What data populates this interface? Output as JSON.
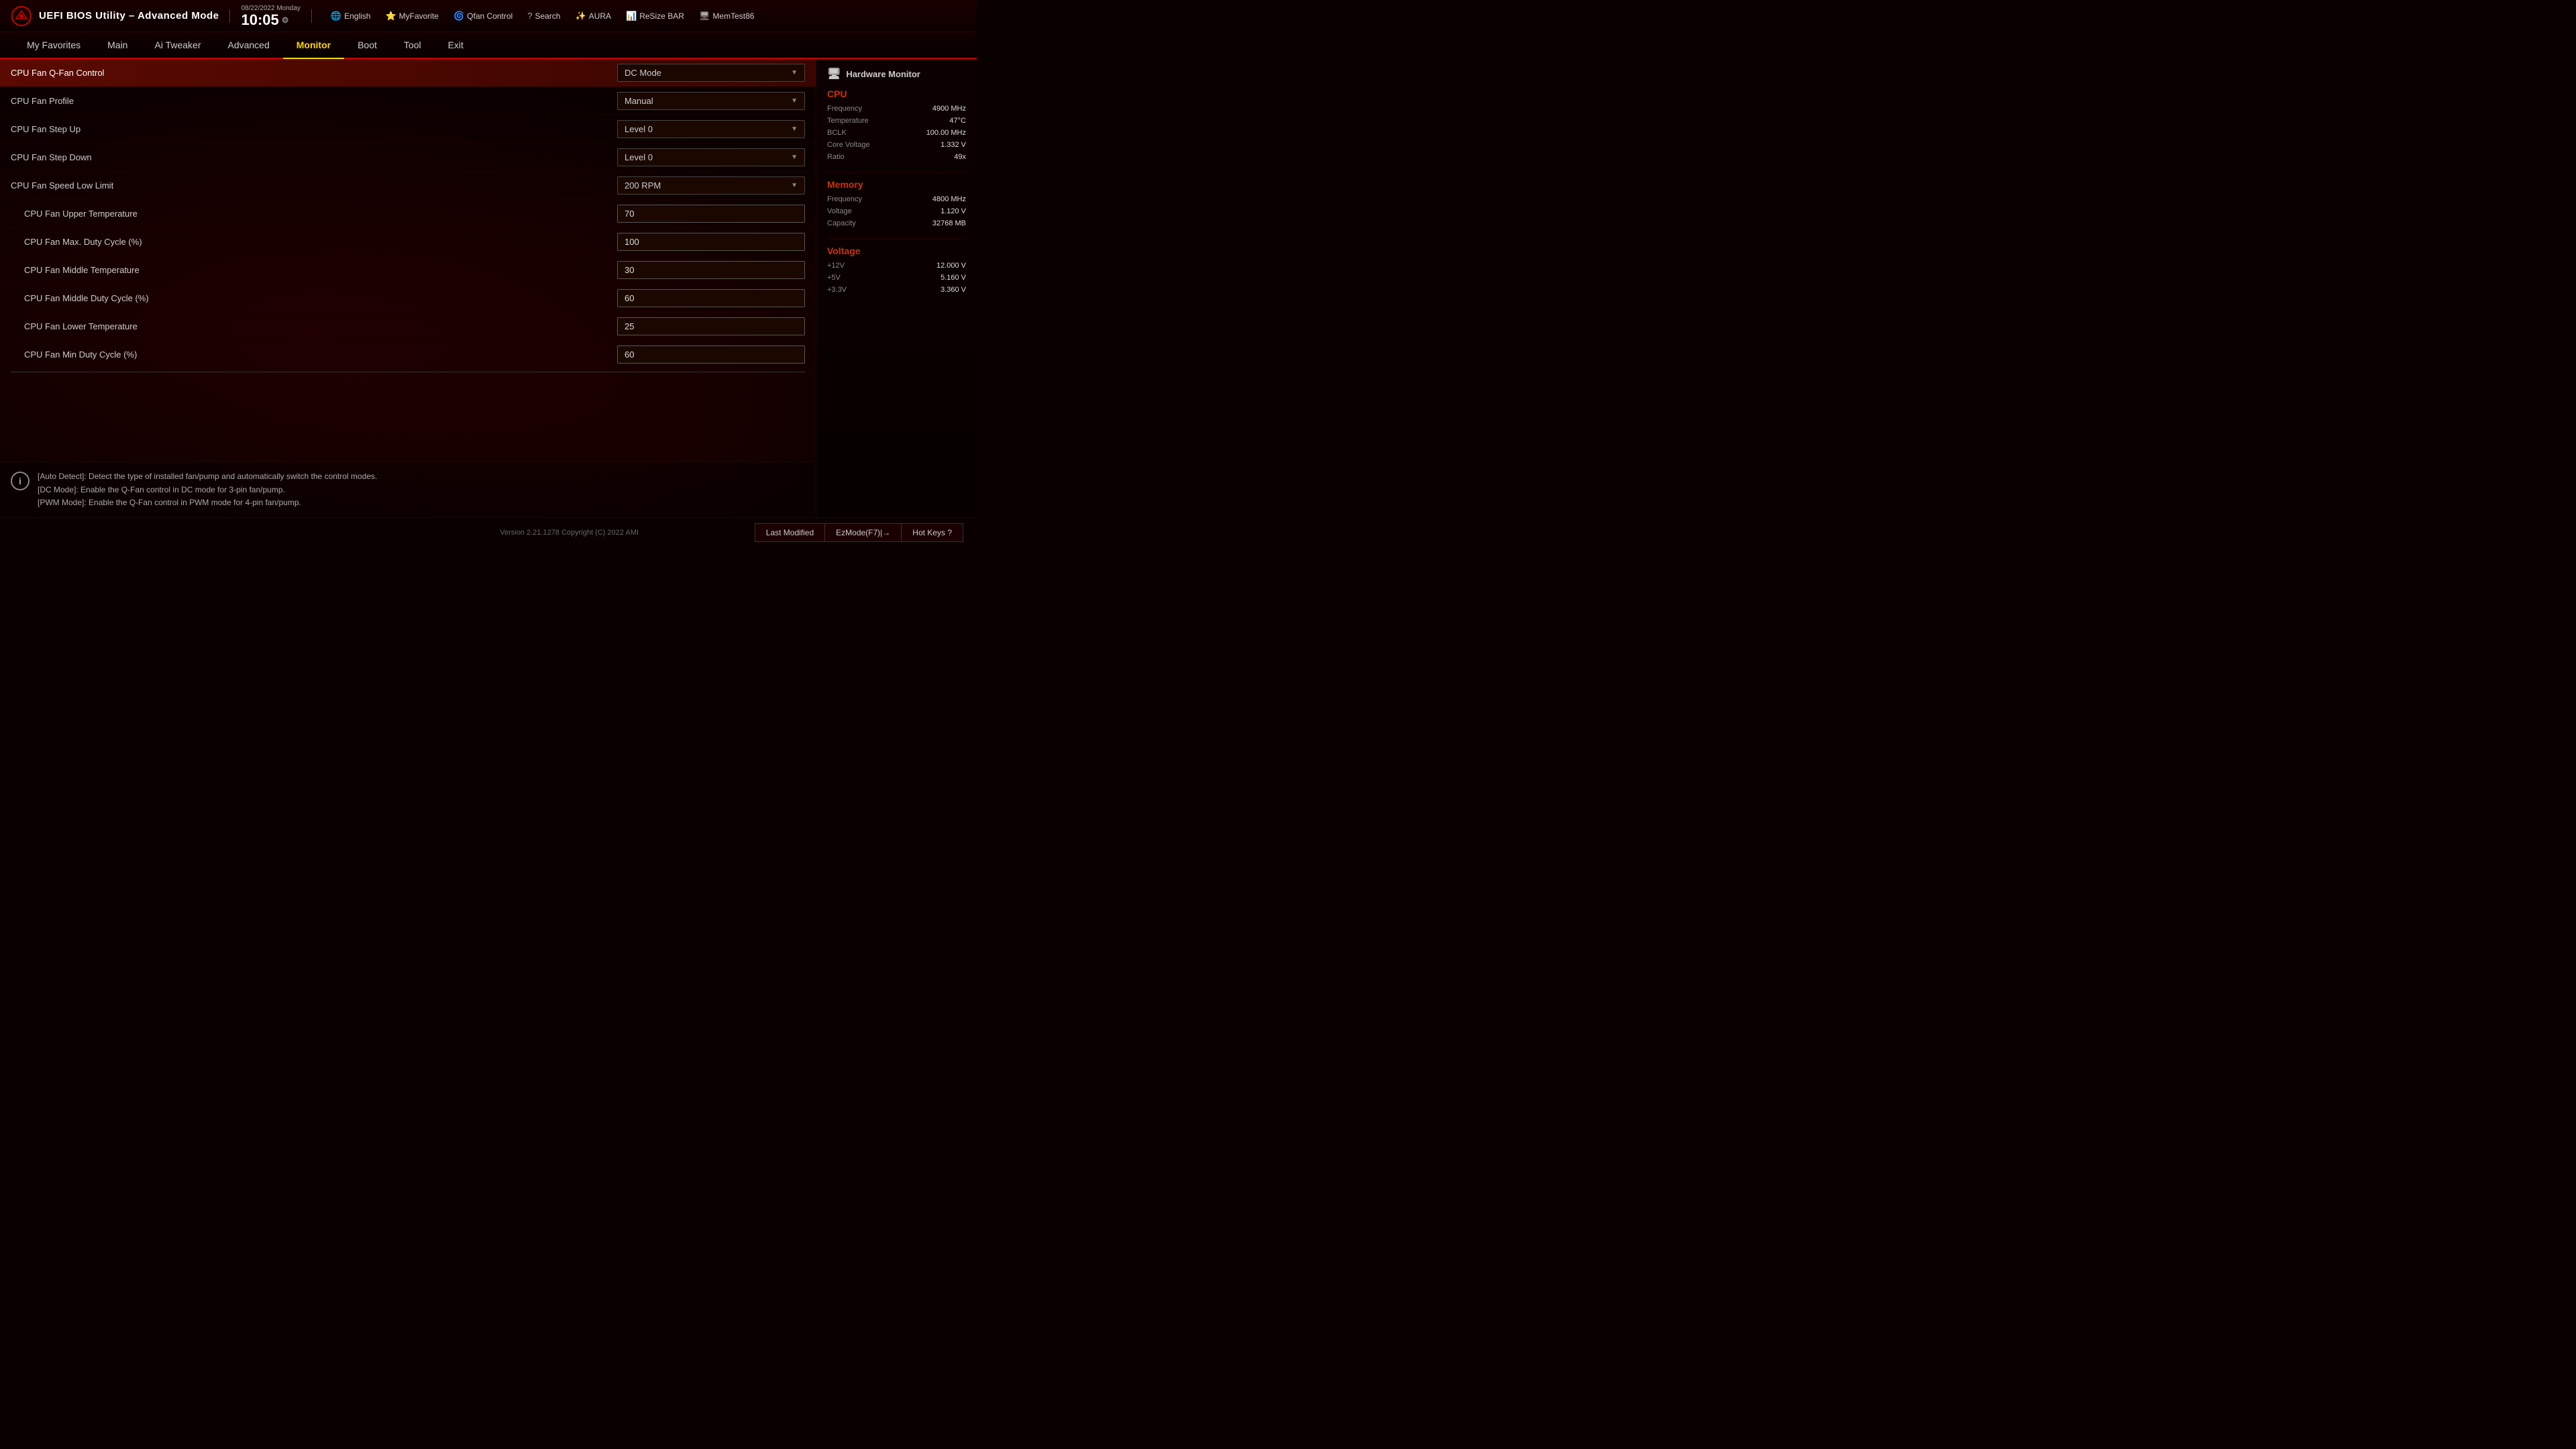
{
  "window": {
    "title": "UEFI BIOS Utility – Advanced Mode"
  },
  "topbar": {
    "date": "08/22/2022",
    "day": "Monday",
    "time": "10:05",
    "gear_symbol": "⚙",
    "actions": [
      {
        "id": "english",
        "icon": "🌐",
        "label": "English"
      },
      {
        "id": "myfavorite",
        "icon": "⭐",
        "label": "MyFavorite"
      },
      {
        "id": "qfan",
        "icon": "🌀",
        "label": "Qfan Control"
      },
      {
        "id": "search",
        "icon": "?",
        "label": "Search"
      },
      {
        "id": "aura",
        "icon": "✨",
        "label": "AURA"
      },
      {
        "id": "resizebar",
        "icon": "📊",
        "label": "ReSize BAR"
      },
      {
        "id": "memtest",
        "icon": "🖥",
        "label": "MemTest86"
      }
    ]
  },
  "nav": {
    "items": [
      {
        "id": "my-favorites",
        "label": "My Favorites",
        "active": false
      },
      {
        "id": "main",
        "label": "Main",
        "active": false
      },
      {
        "id": "ai-tweaker",
        "label": "Ai Tweaker",
        "active": false
      },
      {
        "id": "advanced",
        "label": "Advanced",
        "active": false
      },
      {
        "id": "monitor",
        "label": "Monitor",
        "active": true
      },
      {
        "id": "boot",
        "label": "Boot",
        "active": false
      },
      {
        "id": "tool",
        "label": "Tool",
        "active": false
      },
      {
        "id": "exit",
        "label": "Exit",
        "active": false
      }
    ]
  },
  "settings": {
    "rows": [
      {
        "id": "cpu-fan-qfan-control",
        "label": "CPU Fan Q-Fan Control",
        "type": "dropdown",
        "value": "DC Mode",
        "highlighted": true,
        "indented": false
      },
      {
        "id": "cpu-fan-profile",
        "label": "CPU Fan Profile",
        "type": "dropdown",
        "value": "Manual",
        "highlighted": false,
        "indented": false
      },
      {
        "id": "cpu-fan-step-up",
        "label": "CPU Fan Step Up",
        "type": "dropdown",
        "value": "Level 0",
        "highlighted": false,
        "indented": false
      },
      {
        "id": "cpu-fan-step-down",
        "label": "CPU Fan Step Down",
        "type": "dropdown",
        "value": "Level 0",
        "highlighted": false,
        "indented": false
      },
      {
        "id": "cpu-fan-speed-low-limit",
        "label": "CPU Fan Speed Low Limit",
        "type": "dropdown",
        "value": "200 RPM",
        "highlighted": false,
        "indented": false
      },
      {
        "id": "cpu-fan-upper-temperature",
        "label": "CPU Fan Upper Temperature",
        "type": "input",
        "value": "70",
        "highlighted": false,
        "indented": true
      },
      {
        "id": "cpu-fan-max-duty-cycle",
        "label": "CPU Fan Max. Duty Cycle (%)",
        "type": "input",
        "value": "100",
        "highlighted": false,
        "indented": true
      },
      {
        "id": "cpu-fan-middle-temperature",
        "label": "CPU Fan Middle Temperature",
        "type": "input",
        "value": "30",
        "highlighted": false,
        "indented": true
      },
      {
        "id": "cpu-fan-middle-duty-cycle",
        "label": "CPU Fan Middle Duty Cycle (%)",
        "type": "input",
        "value": "60",
        "highlighted": false,
        "indented": true
      },
      {
        "id": "cpu-fan-lower-temperature",
        "label": "CPU Fan Lower Temperature",
        "type": "input",
        "value": "25",
        "highlighted": false,
        "indented": true
      },
      {
        "id": "cpu-fan-min-duty-cycle",
        "label": "CPU Fan Min Duty Cycle (%)",
        "type": "input",
        "value": "60",
        "highlighted": false,
        "indented": true
      }
    ]
  },
  "info": {
    "icon": "i",
    "lines": [
      "[Auto Detect]: Detect the type of installed fan/pump and automatically switch the control modes.",
      "[DC Mode]: Enable the Q-Fan control in DC mode for 3-pin fan/pump.",
      "[PWM Mode]: Enable the Q-Fan control in PWM mode for 4-pin fan/pump."
    ]
  },
  "hardware_monitor": {
    "title": "Hardware Monitor",
    "icon": "🖥",
    "sections": [
      {
        "id": "cpu",
        "title": "CPU",
        "metrics": [
          {
            "label": "Frequency",
            "value": "4900 MHz"
          },
          {
            "label": "Temperature",
            "value": "47°C"
          },
          {
            "label": "BCLK",
            "value": "100.00 MHz"
          },
          {
            "label": "Core Voltage",
            "value": "1.332 V"
          },
          {
            "label": "Ratio",
            "value": "49x"
          }
        ]
      },
      {
        "id": "memory",
        "title": "Memory",
        "metrics": [
          {
            "label": "Frequency",
            "value": "4800 MHz"
          },
          {
            "label": "Voltage",
            "value": "1.120 V"
          },
          {
            "label": "Capacity",
            "value": "32768 MB"
          }
        ]
      },
      {
        "id": "voltage",
        "title": "Voltage",
        "metrics": [
          {
            "label": "+12V",
            "value": "12.000 V"
          },
          {
            "label": "+5V",
            "value": "5.160 V"
          },
          {
            "label": "+3.3V",
            "value": "3.360 V"
          }
        ]
      }
    ]
  },
  "footer": {
    "version": "Version 2.21.1278 Copyright (C) 2022 AMI",
    "buttons": [
      {
        "id": "last-modified",
        "label": "Last Modified"
      },
      {
        "id": "ezmode",
        "label": "EzMode(F7)|→"
      },
      {
        "id": "hot-keys",
        "label": "Hot Keys ?"
      }
    ]
  }
}
